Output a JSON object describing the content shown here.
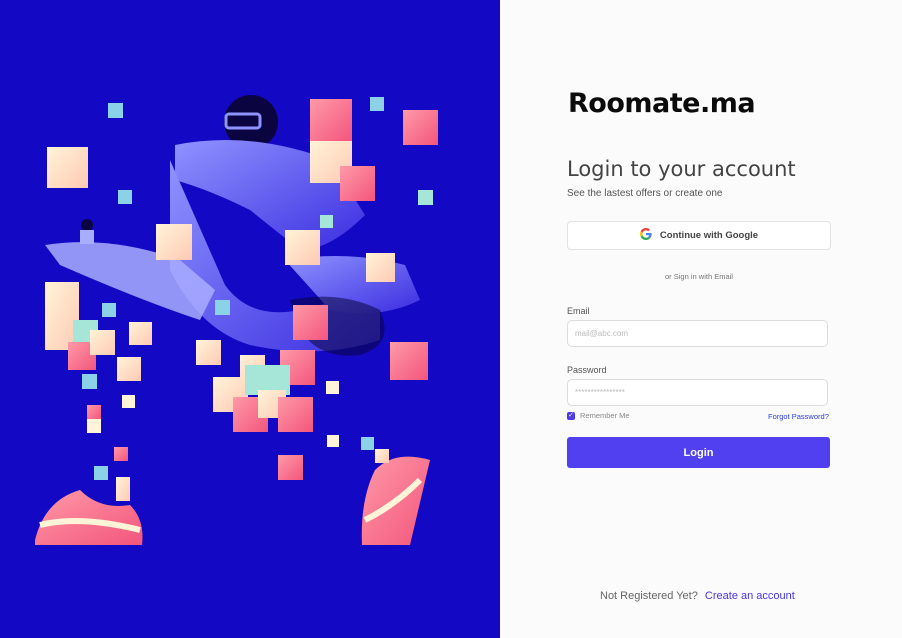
{
  "brand": "Roomate.ma",
  "login": {
    "title": "Login to your account",
    "subtitle": "See the lastest offers or create one",
    "google_label": "Continue with Google",
    "divider": "or Sign in with Email",
    "email_label": "Email",
    "email_placeholder": "mail@abc.com",
    "password_label": "Password",
    "password_placeholder": "****************",
    "remember_label": "Remember Me",
    "remember_checked": true,
    "forgot_label": "Forgot Password?",
    "submit_label": "Login"
  },
  "footer": {
    "prompt": "Not Registered Yet?",
    "link": "Create an account"
  },
  "colors": {
    "illustration_bg": "#1308c4",
    "accent": "#5140f0",
    "link": "#2d3df0"
  },
  "icons": {
    "google": "google-icon"
  }
}
